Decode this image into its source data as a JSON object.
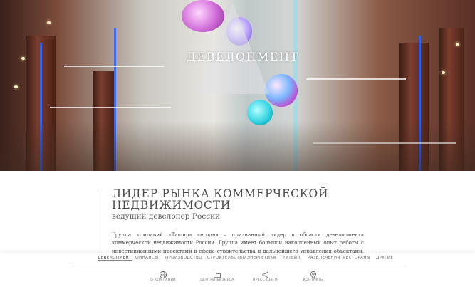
{
  "hero": {
    "title": "ДЕВЕЛОПМЕНТ"
  },
  "content": {
    "heading": "ЛИДЕР РЫНКА КОММЕРЧЕСКОЙ НЕДВИЖИМОСТИ",
    "subheading": "ведущий девелопер России",
    "paragraph": "Группа компаний «Ташир» сегодня – признанный лидер в области девелопмента коммерческой недвижимости России. Группа имеет большой накопленный опыт работы с инвестиционными проектами в сфере строительства и дальнейшего управления объектами, что позволяет «Ташир» много лет подряд"
  },
  "nav": {
    "items": [
      {
        "label": "ДЕВЕЛОПМЕНТ",
        "active": true
      },
      {
        "label": "ФИНАНСЫ"
      },
      {
        "label": "ПРОИЗВОДСТВО"
      },
      {
        "label": "СТРОИТЕЛЬСТВО"
      },
      {
        "label": "ЭНЕРГЕТИКА"
      },
      {
        "label": "РИТЕЙЛ"
      },
      {
        "label": "РАЗВЛЕЧЕНИЯ"
      },
      {
        "label": "РЕСТОРАНЫ"
      },
      {
        "label": "ДРУГИЕ"
      }
    ],
    "tools": [
      {
        "label": "О КОМПАНИИ",
        "icon": "globe-icon"
      },
      {
        "label": "ЦЕНТРЫ БИЗНЕСА",
        "icon": "folder-icon"
      },
      {
        "label": "ПРЕСС-ЦЕНТР",
        "icon": "megaphone-icon"
      },
      {
        "label": "КОНТАКТЫ",
        "icon": "location-pin-icon"
      }
    ]
  }
}
